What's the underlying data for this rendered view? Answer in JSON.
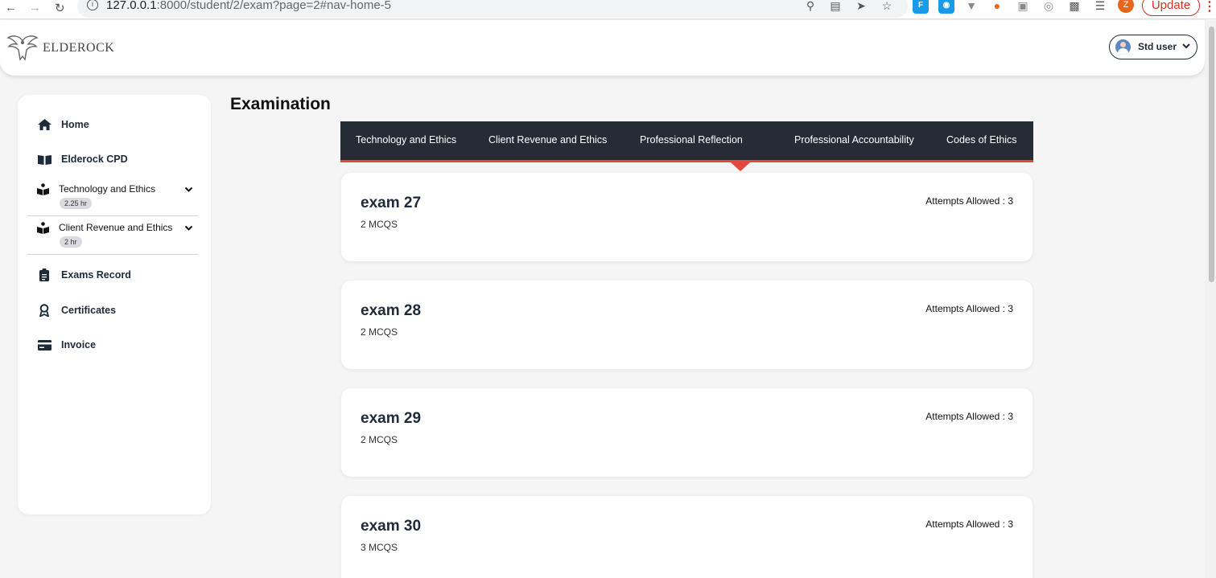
{
  "browser": {
    "url_host": "127.0.0.1",
    "url_rest": ":8000/student/2/exam?page=2#nav-home-5",
    "profile_initial": "Z",
    "update_label": "Update"
  },
  "header": {
    "brand": "ELDEROCK",
    "user_name": "Std user"
  },
  "sidebar": {
    "home": "Home",
    "cpd": "Elderock CPD",
    "courses": [
      {
        "label": "Technology and Ethics",
        "badge": "2.25 hr"
      },
      {
        "label": "Client Revenue and Ethics",
        "badge": "2 hr"
      }
    ],
    "exams_record": "Exams Record",
    "certificates": "Certificates",
    "invoice": "Invoice"
  },
  "main": {
    "title": "Examination",
    "tabs": [
      "Technology and Ethics",
      "Client Revenue and Ethics",
      "Professional Reflection",
      "Professional Accountability",
      "Codes of Ethics"
    ],
    "active_tab_index": 2,
    "exams": [
      {
        "name": "exam 27",
        "mcqs": "2 MCQS",
        "attempts": "Attempts Allowed : 3"
      },
      {
        "name": "exam 28",
        "mcqs": "2 MCQS",
        "attempts": "Attempts Allowed : 3"
      },
      {
        "name": "exam 29",
        "mcqs": "2 MCQS",
        "attempts": "Attempts Allowed : 3"
      },
      {
        "name": "exam 30",
        "mcqs": "3 MCQS",
        "attempts": "Attempts Allowed : 3"
      }
    ]
  },
  "colors": {
    "tab_bg": "#252c35",
    "accent": "#e2463c",
    "text_dark": "#1e2a3a"
  }
}
